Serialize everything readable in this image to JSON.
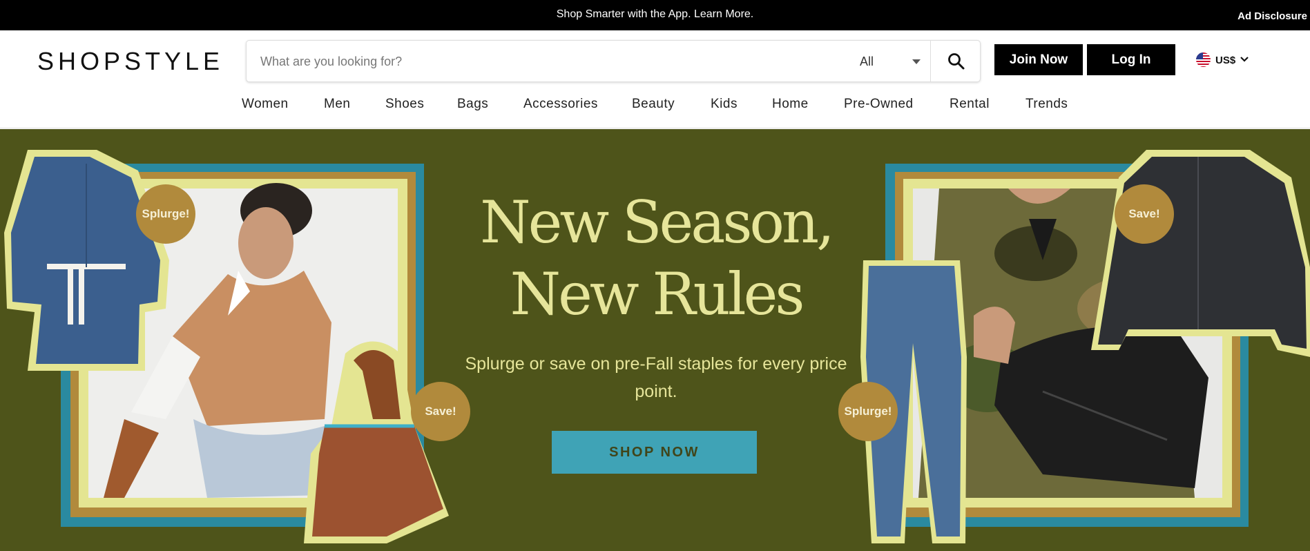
{
  "promo_bar": {
    "text": "Shop Smarter with the App. Learn More.",
    "ad_disclosure": "Ad Disclosure",
    "background": "#000000"
  },
  "header": {
    "logo": "SHOPSTYLE",
    "search": {
      "placeholder": "What are you looking for?",
      "value": "",
      "scope_selected": "All",
      "icon": "search-icon"
    },
    "join_now": "Join Now",
    "log_in": "Log In",
    "currency": {
      "label": "US$",
      "flag": "us-flag-icon",
      "icon": "chevron-down-icon"
    }
  },
  "nav": {
    "items": [
      {
        "label": "Women"
      },
      {
        "label": "Men"
      },
      {
        "label": "Shoes"
      },
      {
        "label": "Bags"
      },
      {
        "label": "Accessories"
      },
      {
        "label": "Beauty"
      },
      {
        "label": "Kids"
      },
      {
        "label": "Home"
      },
      {
        "label": "Pre-Owned"
      },
      {
        "label": "Rental"
      },
      {
        "label": "Trends"
      }
    ]
  },
  "hero": {
    "title_line1": "New Season,",
    "title_line2": "New Rules",
    "subtitle": "Splurge or save on pre-Fall staples for every price point.",
    "cta": "SHOP NOW",
    "badges": {
      "denim_dress": "Splurge!",
      "handbag": "Save!",
      "denim_jacket": "Save!",
      "jeans": "Splurge!"
    },
    "colors": {
      "background": "#4e541a",
      "accent_text": "#e6e59a",
      "cta": "#3fa3b6",
      "badge": "#b18a3c"
    }
  }
}
